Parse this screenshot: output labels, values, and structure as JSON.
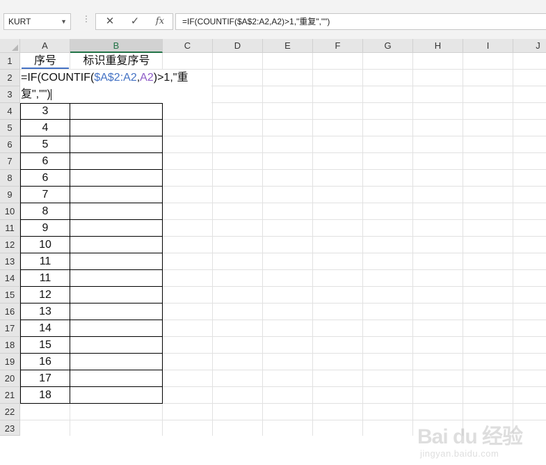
{
  "namebox": {
    "value": "KURT"
  },
  "formula_bar": {
    "cancel_glyph": "✕",
    "enter_glyph": "✓",
    "fx_glyph": "fx",
    "text": "=IF(COUNTIF($A$2:A2,A2)>1,\"重复\",\"\")"
  },
  "columns": [
    "A",
    "B",
    "C",
    "D",
    "E",
    "F",
    "G",
    "H",
    "I",
    "J"
  ],
  "rows": [
    "1",
    "2",
    "3",
    "4",
    "5",
    "6",
    "7",
    "8",
    "9",
    "10",
    "11",
    "12",
    "13",
    "14",
    "15",
    "16",
    "17",
    "18",
    "19",
    "20",
    "21",
    "22",
    "23"
  ],
  "header": {
    "a1": "序号",
    "b1": "标识重复序号"
  },
  "editing_cell": {
    "part1": "=IF(COUNTIF(",
    "ref1": "$A$2:A2",
    "comma": ",",
    "ref2": "A2",
    "part2": ")>1,\"重",
    "line2": "复\",\"\")"
  },
  "values": [
    "3",
    "4",
    "5",
    "6",
    "6",
    "7",
    "8",
    "9",
    "10",
    "11",
    "11",
    "12",
    "13",
    "14",
    "15",
    "16",
    "17",
    "18"
  ],
  "watermark": {
    "text": "Bai du 经验",
    "url": "jingyan.baidu.com"
  },
  "colors": {
    "accent": "#217346",
    "ref1": "#4472c4",
    "ref2": "#8e5cc7"
  }
}
